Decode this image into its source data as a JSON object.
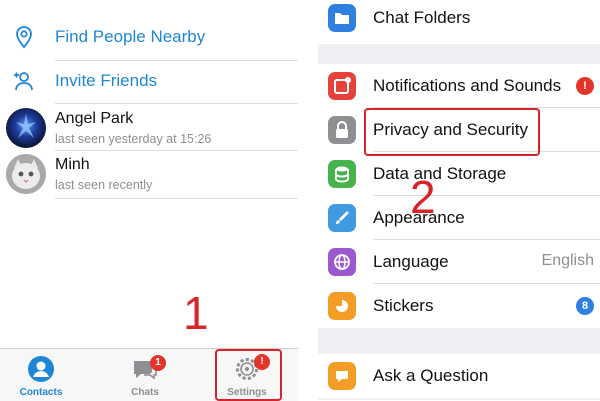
{
  "left_panel": {
    "actions": [
      {
        "label": "Find People Nearby",
        "icon": "location-pin-icon"
      },
      {
        "label": "Invite Friends",
        "icon": "add-person-icon"
      }
    ],
    "contacts": [
      {
        "name": "Angel Park",
        "status": "last seen yesterday at 15:26",
        "avatar": "dark-blue-avatar"
      },
      {
        "name": "Minh",
        "status": "last seen recently",
        "avatar": "cat-avatar"
      }
    ],
    "tabbar": {
      "tabs": [
        {
          "label": "Contacts",
          "icon": "person-circle-icon",
          "active": true
        },
        {
          "label": "Chats",
          "icon": "chat-bubbles-icon",
          "badge": "1"
        },
        {
          "label": "Settings",
          "icon": "gear-icon",
          "badge": "!"
        }
      ]
    },
    "annotation": "1"
  },
  "right_panel": {
    "items": [
      {
        "label": "Chat Folders",
        "icon": "folder-icon",
        "color": "#2f7fe0"
      },
      {
        "label": "Notifications and Sounds",
        "icon": "notification-icon",
        "color": "#e5433a",
        "badge": "!"
      },
      {
        "label": "Privacy and Security",
        "icon": "lock-icon",
        "color": "#8e8e93"
      },
      {
        "label": "Data and Storage",
        "icon": "database-icon",
        "color": "#47b34b"
      },
      {
        "label": "Appearance",
        "icon": "brush-icon",
        "color": "#3f9ae0"
      },
      {
        "label": "Language",
        "icon": "globe-icon",
        "color": "#9b59d0",
        "value": "English"
      },
      {
        "label": "Stickers",
        "icon": "sticker-icon",
        "color": "#f39c26",
        "badge": "8"
      },
      {
        "label": "Ask a Question",
        "icon": "question-icon",
        "color": "#f39c26"
      }
    ],
    "annotation": "2"
  },
  "colors": {
    "accent": "#1f86d6",
    "annotation": "#d6242a",
    "badge": "#e5352a",
    "sticker_badge": "#2f7fe0"
  }
}
